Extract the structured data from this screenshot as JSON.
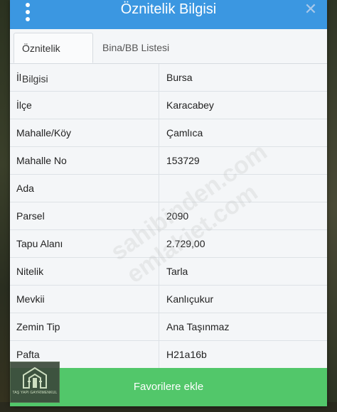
{
  "dialog": {
    "title": "Öznitelik Bilgisi",
    "close_glyph": "✕"
  },
  "tabs": [
    {
      "label": "Öznitelik Bilgisi",
      "active": true
    },
    {
      "label": "Bina/BB Listesi",
      "active": false
    }
  ],
  "attributes": [
    {
      "key": "İl",
      "value": "Bursa"
    },
    {
      "key": "İlçe",
      "value": "Karacabey"
    },
    {
      "key": "Mahalle/Köy",
      "value": "Çamlıca"
    },
    {
      "key": "Mahalle No",
      "value": "153729"
    },
    {
      "key": "Ada",
      "value": ""
    },
    {
      "key": "Parsel",
      "value": "2090"
    },
    {
      "key": "Tapu Alanı",
      "value": "2.729,00"
    },
    {
      "key": "Nitelik",
      "value": "Tarla"
    },
    {
      "key": "Mevkii",
      "value": "Kanlıçukur"
    },
    {
      "key": "Zemin Tip",
      "value": "Ana Taşınmaz"
    },
    {
      "key": "Pafta",
      "value": "H21a16b"
    }
  ],
  "footer": {
    "button_label": "Favorilere ekle"
  },
  "watermark": {
    "text": "sahibinden.com emlakjet.com"
  },
  "logo": {
    "text": "TAŞ YAPI GAYRİMENKUL"
  },
  "colors": {
    "header": "#3b97e1",
    "footer": "#52c76a",
    "background": "#f4f6f8"
  },
  "icons": {
    "menu": "more-vertical-icon",
    "close": "close-icon",
    "logo": "building-logo-icon"
  }
}
